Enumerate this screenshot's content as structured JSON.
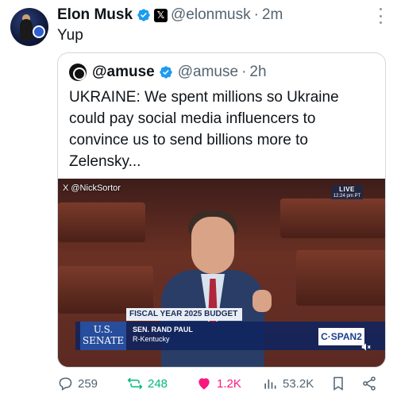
{
  "tweet": {
    "author_name": "Elon Musk",
    "author_handle": "@elonmusk",
    "separator": "·",
    "time": "2m",
    "text": "Yup"
  },
  "quoted_tweet": {
    "author_name": "@amuse",
    "author_handle": "@amuse",
    "separator": "·",
    "time": "2h",
    "text": "UKRAINE: We spent millions so Ukraine could pay social media influencers to convince us to send billions more to Zelensky..."
  },
  "video": {
    "source_tag": "X @NickSortor",
    "live_label": "LIVE",
    "live_time": "12:24 pm PT",
    "budget_banner": "FISCAL YEAR 2025 BUDGET",
    "network_line1": "U.S.",
    "network_line2": "SENATE",
    "speaker_name": "SEN. RAND PAUL",
    "speaker_state": "R-Kentucky",
    "channel": "C·SPAN2"
  },
  "actions": {
    "replies": "259",
    "reposts": "248",
    "likes": "1.2K",
    "views": "53.2K"
  },
  "colors": {
    "verified": "#1d9bf0",
    "repost_active": "#00ba7c",
    "like_active": "#f91880",
    "muted_text": "#536471"
  }
}
